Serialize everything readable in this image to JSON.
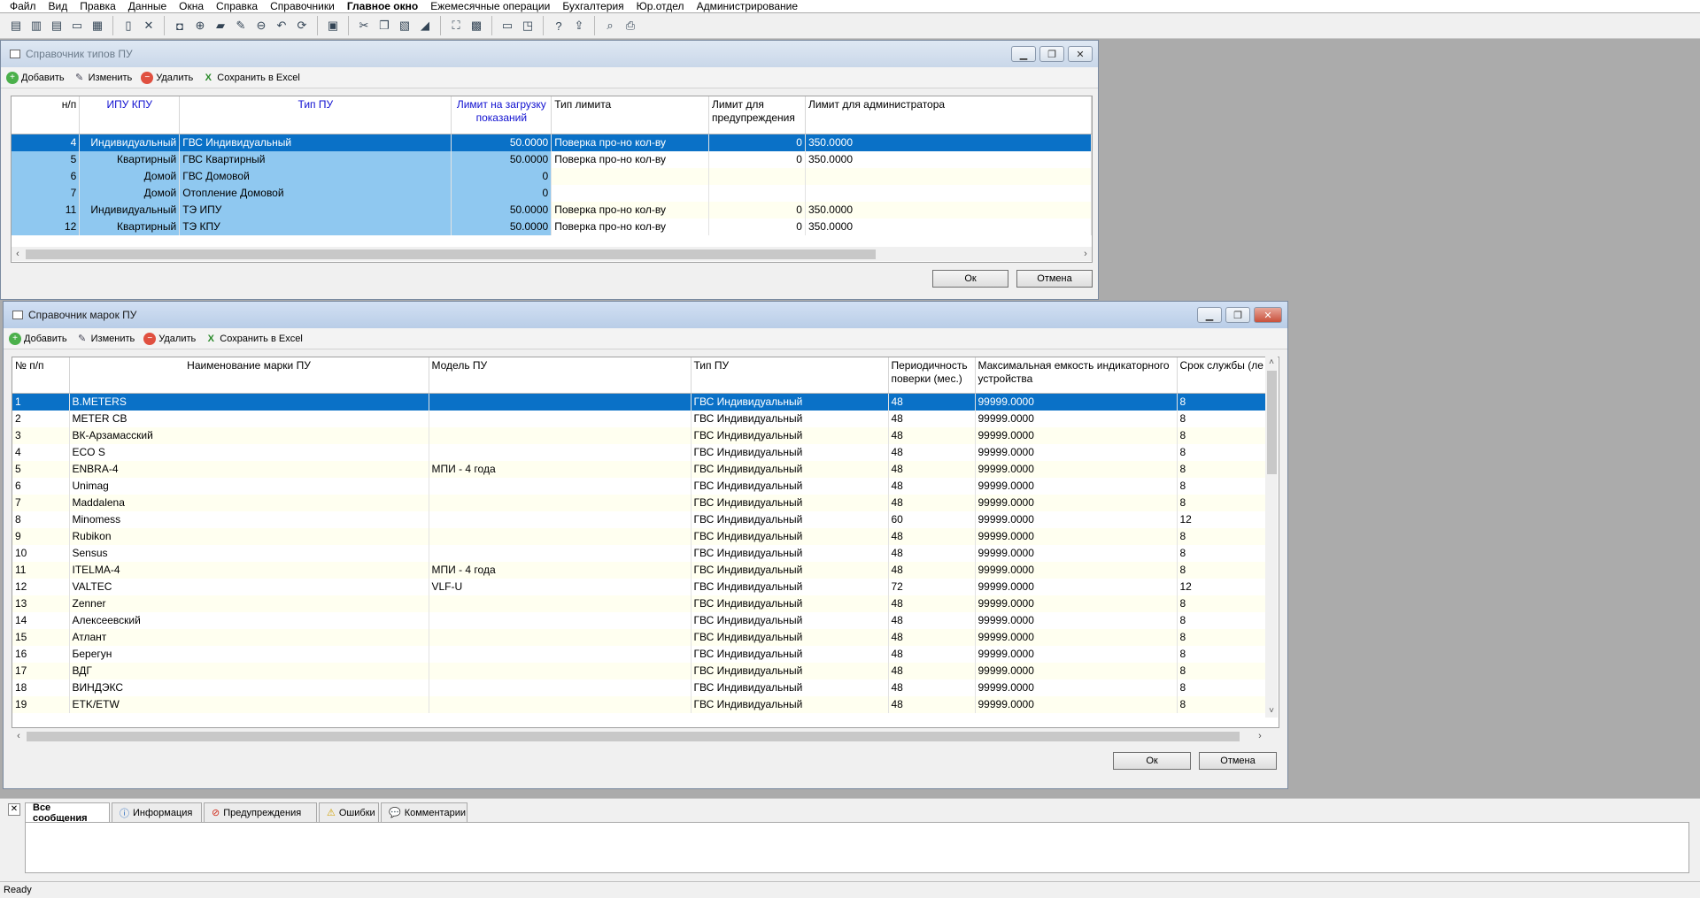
{
  "menu": [
    "Файл",
    "Вид",
    "Правка",
    "Данные",
    "Окна",
    "Справка",
    "Справочники",
    "Главное окно",
    "Ежемесячные операции",
    "Бухгалтерия",
    "Юр.отдел",
    "Администрирование"
  ],
  "toolbar_icons": [
    "window-cascade-icon",
    "window-tile-vertical-icon",
    "window-tile-horizontal-icon",
    "window-single-icon",
    "window-grid-icon",
    "document-icon",
    "close-icon",
    "camera-icon",
    "add-circle-icon",
    "folder-icon",
    "edit-icon",
    "delete-circle-icon",
    "undo-icon",
    "refresh-icon",
    "save-icon",
    "cut-icon",
    "copy-icon",
    "paste-icon",
    "eraser-icon",
    "fullscreen-icon",
    "calendar-icon",
    "window-icon",
    "window-add-icon",
    "help-icon",
    "export-icon",
    "search-icon",
    "print-icon"
  ],
  "win1": {
    "title": "Справочник типов ПУ",
    "toolbar": {
      "add": "Добавить",
      "edit": "Изменить",
      "delete": "Удалить",
      "excel": "Сохранить в Excel"
    },
    "headers": [
      "н/п",
      "ИПУ КПУ",
      "Тип ПУ",
      "Лимит на загрузку показаний",
      "Тип лимита",
      "Лимит для предупреждения",
      "Лимит для администратора"
    ],
    "rows": [
      [
        "4",
        "Индивидуальный",
        "ГВС Индивидуальный",
        "50.0000",
        "Поверка про-но кол-ву",
        "0",
        "350.0000"
      ],
      [
        "5",
        "Квартирный",
        "ГВС Квартирный",
        "50.0000",
        "Поверка про-но кол-ву",
        "0",
        "350.0000"
      ],
      [
        "6",
        "Домой",
        "ГВС Домовой",
        "0",
        "",
        "",
        ""
      ],
      [
        "7",
        "Домой",
        "Отопление Домовой",
        "0",
        "",
        "",
        ""
      ],
      [
        "11",
        "Индивидуальный",
        "ТЭ ИПУ",
        "50.0000",
        "Поверка про-но кол-ву",
        "0",
        "350.0000"
      ],
      [
        "12",
        "Квартирный",
        "ТЭ КПУ",
        "50.0000",
        "Поверка про-но кол-ву",
        "0",
        "350.0000"
      ]
    ],
    "ok": "Ок",
    "cancel": "Отмена"
  },
  "win2": {
    "title": "Справочник марок ПУ",
    "toolbar": {
      "add": "Добавить",
      "edit": "Изменить",
      "delete": "Удалить",
      "excel": "Сохранить в Excel"
    },
    "headers": [
      "№ п/п",
      "Наименование марки ПУ",
      "Модель ПУ",
      "Тип ПУ",
      "Периодичность поверки (мес.)",
      "Максимальная емкость индикаторного устройства",
      "Срок службы (ле"
    ],
    "rows": [
      [
        "1",
        "B.METERS",
        "",
        "ГВС Индивидуальный",
        "48",
        "99999.0000",
        "8"
      ],
      [
        "2",
        "METER CB",
        "",
        "ГВС Индивидуальный",
        "48",
        "99999.0000",
        "8"
      ],
      [
        "3",
        "ВК-Арзамасский",
        "",
        "ГВС Индивидуальный",
        "48",
        "99999.0000",
        "8"
      ],
      [
        "4",
        "ECO S",
        "",
        "ГВС Индивидуальный",
        "48",
        "99999.0000",
        "8"
      ],
      [
        "5",
        "ENBRA-4",
        "МПИ - 4 года",
        "ГВС Индивидуальный",
        "48",
        "99999.0000",
        "8"
      ],
      [
        "6",
        "Unimag",
        "",
        "ГВС Индивидуальный",
        "48",
        "99999.0000",
        "8"
      ],
      [
        "7",
        "Maddalena",
        "",
        "ГВС Индивидуальный",
        "48",
        "99999.0000",
        "8"
      ],
      [
        "8",
        "Minomess",
        "",
        "ГВС Индивидуальный",
        "60",
        "99999.0000",
        "12"
      ],
      [
        "9",
        "Rubikon",
        "",
        "ГВС Индивидуальный",
        "48",
        "99999.0000",
        "8"
      ],
      [
        "10",
        "Sensus",
        "",
        "ГВС Индивидуальный",
        "48",
        "99999.0000",
        "8"
      ],
      [
        "11",
        "ITELMA-4",
        "МПИ - 4 года",
        "ГВС Индивидуальный",
        "48",
        "99999.0000",
        "8"
      ],
      [
        "12",
        "VALTEC",
        "VLF-U",
        "ГВС Индивидуальный",
        "72",
        "99999.0000",
        "12"
      ],
      [
        "13",
        "Zenner",
        "",
        "ГВС Индивидуальный",
        "48",
        "99999.0000",
        "8"
      ],
      [
        "14",
        "Алексеевский",
        "",
        "ГВС Индивидуальный",
        "48",
        "99999.0000",
        "8"
      ],
      [
        "15",
        "Атлант",
        "",
        "ГВС Индивидуальный",
        "48",
        "99999.0000",
        "8"
      ],
      [
        "16",
        "Берегун",
        "",
        "ГВС Индивидуальный",
        "48",
        "99999.0000",
        "8"
      ],
      [
        "17",
        "ВДГ",
        "",
        "ГВС Индивидуальный",
        "48",
        "99999.0000",
        "8"
      ],
      [
        "18",
        "ВИНДЭКС",
        "",
        "ГВС Индивидуальный",
        "48",
        "99999.0000",
        "8"
      ],
      [
        "19",
        "ETK/ETW",
        "",
        "ГВС Индивидуальный",
        "48",
        "99999.0000",
        "8"
      ]
    ],
    "ok": "Ок",
    "cancel": "Отмена"
  },
  "messages": {
    "tabs": [
      "Все сообщения",
      "Информация",
      "Предупреждения",
      "Ошибки",
      "Комментарии"
    ]
  },
  "status": "Ready"
}
